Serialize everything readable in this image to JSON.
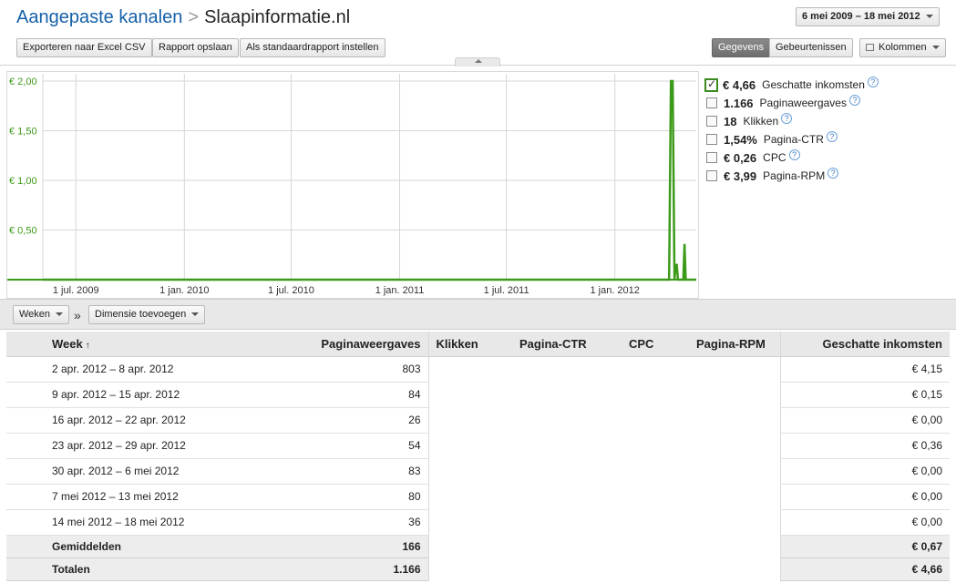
{
  "header": {
    "breadcrumb_parent": "Aangepaste kanalen",
    "breadcrumb_separator": ">",
    "breadcrumb_current": "Slaapinformatie.nl",
    "date_range": "6 mei 2009 – 18 mei 2012"
  },
  "toolbar": {
    "export_label": "Exporteren naar Excel CSV",
    "save_label": "Rapport opslaan",
    "default_label": "Als standaardrapport instellen",
    "data_tab": "Gegevens",
    "events_tab": "Gebeurtenissen",
    "columns_label": "Kolommen"
  },
  "chart_data": {
    "type": "line",
    "y_ticks": [
      "€ 2,00",
      "€ 1,50",
      "€ 1,00",
      "€ 0,50"
    ],
    "x_ticks": [
      "1 jul. 2009",
      "1 jan. 2010",
      "1 jul. 2010",
      "1 jan. 2011",
      "1 jul. 2011",
      "1 jan. 2012"
    ],
    "ylim": [
      0,
      2.0
    ],
    "x_range": [
      "2009-05-06",
      "2012-05-18"
    ],
    "grid": true,
    "series": [
      {
        "color": "#3c9a1a",
        "points": [
          {
            "x": "2009-05-06",
            "y": 0.0
          },
          {
            "x": "2012-03-25",
            "y": 0.0
          },
          {
            "x": "2012-04-02",
            "y": 0.0
          },
          {
            "x": "2012-04-05",
            "y": 2.0
          },
          {
            "x": "2012-04-08",
            "y": 2.0
          },
          {
            "x": "2012-04-11",
            "y": 0.0
          },
          {
            "x": "2012-04-13",
            "y": 0.15
          },
          {
            "x": "2012-04-15",
            "y": 0.15
          },
          {
            "x": "2012-04-17",
            "y": 0.0
          },
          {
            "x": "2012-04-26",
            "y": 0.0
          },
          {
            "x": "2012-04-28",
            "y": 0.36
          },
          {
            "x": "2012-04-30",
            "y": 0.0
          },
          {
            "x": "2012-05-18",
            "y": 0.0
          }
        ]
      }
    ]
  },
  "legend": [
    {
      "value": "€ 4,66",
      "label": "Geschatte inkomsten",
      "checked": true
    },
    {
      "value": "1.166",
      "label": "Paginaweergaves",
      "checked": false
    },
    {
      "value": "18",
      "label": "Klikken",
      "checked": false
    },
    {
      "value": "1,54%",
      "label": "Pagina-CTR",
      "checked": false
    },
    {
      "value": "€ 0,26",
      "label": "CPC",
      "checked": false
    },
    {
      "value": "€ 3,99",
      "label": "Pagina-RPM",
      "checked": false
    }
  ],
  "filters": {
    "period_label": "Weken",
    "separator": "»",
    "dimension_label": "Dimensie toevoegen"
  },
  "table": {
    "headers": {
      "week": "Week",
      "sort": "↑",
      "pageviews": "Paginaweergaves",
      "clicks": "Klikken",
      "ctr": "Pagina-CTR",
      "cpc": "CPC",
      "rpm": "Pagina-RPM",
      "revenue": "Geschatte inkomsten"
    },
    "rows": [
      {
        "week": "2 apr. 2012 – 8 apr. 2012",
        "pageviews": "803",
        "revenue": "€ 4,15"
      },
      {
        "week": "9 apr. 2012 – 15 apr. 2012",
        "pageviews": "84",
        "revenue": "€ 0,15"
      },
      {
        "week": "16 apr. 2012 – 22 apr. 2012",
        "pageviews": "26",
        "revenue": "€ 0,00"
      },
      {
        "week": "23 apr. 2012 – 29 apr. 2012",
        "pageviews": "54",
        "revenue": "€ 0,36"
      },
      {
        "week": "30 apr. 2012 – 6 mei 2012",
        "pageviews": "83",
        "revenue": "€ 0,00"
      },
      {
        "week": "7 mei 2012 – 13 mei 2012",
        "pageviews": "80",
        "revenue": "€ 0,00"
      },
      {
        "week": "14 mei 2012 – 18 mei 2012",
        "pageviews": "36",
        "revenue": "€ 0,00"
      }
    ],
    "averages": {
      "label": "Gemiddelden",
      "pageviews": "166",
      "revenue": "€ 0,67"
    },
    "totals": {
      "label": "Totalen",
      "pageviews": "1.166",
      "revenue": "€ 4,66"
    }
  }
}
